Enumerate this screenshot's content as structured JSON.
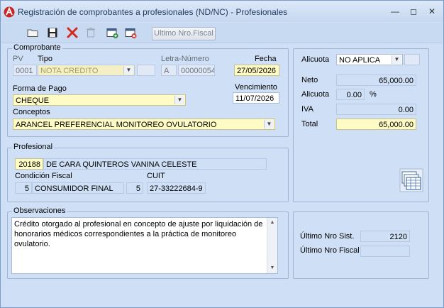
{
  "window": {
    "title": "Registración de comprobantes a profesionales (ND/NC) - Profesionales",
    "minimize_glyph": "—",
    "restore_glyph": "◻",
    "close_glyph": "✕"
  },
  "toolbar": {
    "icons": [
      "open-folder-icon",
      "save-icon",
      "delete-x-icon",
      "trash-icon",
      "add-calendar-icon",
      "remove-calendar-icon"
    ],
    "ultimo_nro_fiscal_label": "Ultimo Nro.Fiscal"
  },
  "comprobante": {
    "group_label": "Comprobante",
    "pv_label": "PV",
    "pv_value": "0001",
    "tipo_label": "Tipo",
    "tipo_value": "NOTA CREDITO",
    "letra_numero_label": "Letra-Número",
    "letra_value": "A",
    "numero_value": "00000054",
    "fecha_label": "Fecha",
    "fecha_value": "27/05/2026",
    "forma_pago_label": "Forma de Pago",
    "forma_pago_value": "CHEQUE",
    "vencimiento_label": "Vencimiento",
    "vencimiento_value": "11/07/2026",
    "conceptos_label": "Conceptos",
    "conceptos_value": "ARANCEL PREFERENCIAL  MONITOREO OVULATORIO"
  },
  "profesional": {
    "group_label": "Profesional",
    "codigo": "20188",
    "nombre": "DE CARA QUINTEROS VANINA CELESTE",
    "condicion_fiscal_label": "Condición Fiscal",
    "condicion_codigo": "5",
    "condicion_value": "CONSUMIDOR FINAL",
    "cuit_label": "CUIT",
    "cuit_tipo": "5",
    "cuit_value": "27-33222684-9"
  },
  "observaciones": {
    "group_label": "Observaciones",
    "text": "Crédito otorgado al profesional en concepto de ajuste por liquidación de honorarios médicos correspondientes a la práctica de monitoreo ovulatorio."
  },
  "totales": {
    "alicuota_label": "Alicuota",
    "alicuota_value": "NO APLICA",
    "neto_label": "Neto",
    "neto_value": "65,000.00",
    "alicuota2_label": "Alicuota",
    "alicuota_pct_value": "0.00",
    "pct_symbol": "%",
    "iva_label": "IVA",
    "iva_value": "0.00",
    "total_label": "Total",
    "total_value": "65,000.00"
  },
  "numeracion": {
    "ultimo_nro_sist_label": "Último Nro Sist.",
    "ultimo_nro_sist_value": "2120",
    "ultimo_nro_fiscal_label": "Último Nro Fiscal",
    "ultimo_nro_fiscal_value": ""
  },
  "colors": {
    "window_bg": "#cfdff5",
    "yellow_field": "#fffbc4",
    "accent_red": "#d52b1e"
  }
}
